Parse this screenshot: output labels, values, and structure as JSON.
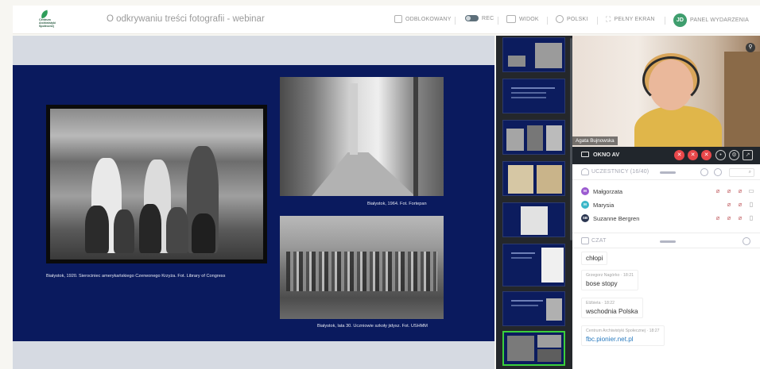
{
  "header": {
    "logo_text": [
      "Centrum",
      "Archiwistyki",
      "Społecznej"
    ],
    "title": "O odkrywaniu treści fotografii - webinar",
    "unlocked_label": "ODBLOKOWANY",
    "rec_label": "REC",
    "view_label": "WIDOK",
    "language_label": "POLSKI",
    "fullscreen_label": "PEŁNY EKRAN",
    "user_initials": "JD",
    "panel_label": "PANEL WYDARZENIA"
  },
  "slide": {
    "caption_left": "Białystok, 1920. Sierociniec amerykańskiego Czerwonego Krzyża. Fot. Library of Congress",
    "caption_top_right": "Białystok, 1964. Fot. Fortepan",
    "caption_bottom_right": "Białystok, lata 30. Uczniowie szkoły jidysz. Fot. USHMM"
  },
  "thumbnails": {
    "count": 8,
    "active_index": 7
  },
  "video": {
    "presenter_name": "Agata Bujnowska",
    "av_window_label": "OKNO AV"
  },
  "participants": {
    "header_label": "UCZESTNICY (16/40)",
    "search_icon": "search-icon",
    "list": [
      {
        "initial": "M",
        "name": "Małgorzata",
        "color": "#9b5bd0"
      },
      {
        "initial": "M",
        "name": "Marysia",
        "color": "#3bb6c8"
      },
      {
        "initial": "SB",
        "name": "Suzanne Bergren",
        "color": "#2a3550"
      }
    ]
  },
  "chat": {
    "header_label": "CZAT",
    "messages": [
      {
        "meta": "",
        "text": "chłopi"
      },
      {
        "meta": "Grzegorz Nagórko · 18:21",
        "text": "bose stopy"
      },
      {
        "meta": "Elżbieta · 18:22",
        "text": "wschodnia Polska"
      },
      {
        "meta": "Centrum Archiwistyki Społecznej · 18:27",
        "text": "fbc.pionier.net.pl"
      }
    ]
  },
  "colors": {
    "slide_bg": "#0a1a5e",
    "accent_green": "#3bcf3b",
    "alert_red": "#e8474a"
  }
}
